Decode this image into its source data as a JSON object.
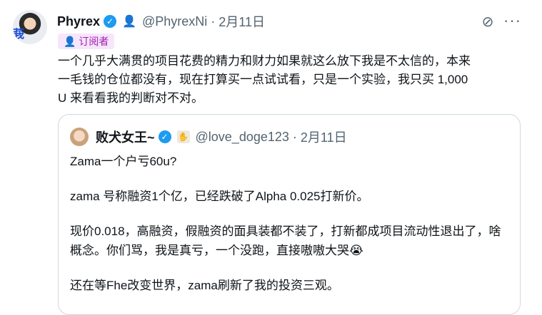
{
  "tweet": {
    "display_name": "Phyrex",
    "handle": "@PhyrexNi",
    "separator": "·",
    "date": "2月11日",
    "verified_icon": "verified-badge-icon",
    "subscriber_icon": "subscriber-icon",
    "badge_label": "订阅者",
    "more_label": "···",
    "body_lines": [
      "一个几乎大满贯的项目花费的精力和财力如果就这么放下我是不太信的，本来",
      "一毛钱的仓位都没有，现在打算买一点试试看，只是一个实验，我只买 1,000",
      "U 来看看我的判断对不对。"
    ]
  },
  "quoted": {
    "display_name": "败犬女王~",
    "handle": "@love_doge123",
    "separator": "·",
    "date": "2月11日",
    "paragraphs": [
      "Zama一个户亏60u?",
      "zama 号称融资1个亿，已经跌破了Alpha 0.025打新价。",
      "现价0.018，高融资，假融资的面具装都不装了，打新都成项目流动性退出了，啥概念。你们骂，我是真亏，一个没跑，直接嗷嗷大哭😭",
      "还在等Fhe改变世界，zama刷新了我的投资三观。"
    ]
  },
  "colors": {
    "accent": "#1d9bf0",
    "secondary_text": "#536471",
    "subscriber": "#a21caf",
    "border": "#cfd9de"
  }
}
